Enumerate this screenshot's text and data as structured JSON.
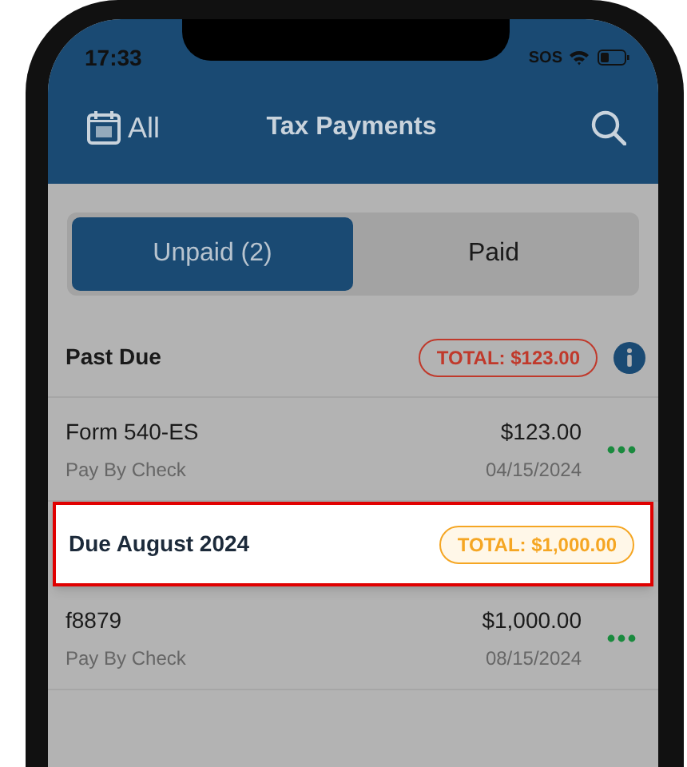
{
  "status_bar": {
    "time": "17:33",
    "carrier": "SOS"
  },
  "nav": {
    "left_label": "All",
    "title": "Tax Payments"
  },
  "tabs": [
    {
      "label": "Unpaid (2)",
      "selected": true
    },
    {
      "label": "Paid",
      "selected": false
    }
  ],
  "sections": [
    {
      "title": "Past Due",
      "total": "TOTAL: $123.00",
      "color": "#c0392b",
      "info": true,
      "highlighted": false,
      "items": [
        {
          "name": "Form 540-ES",
          "method": "Pay By Check",
          "amount": "$123.00",
          "date": "04/15/2024"
        }
      ]
    },
    {
      "title": "Due August 2024",
      "total": "TOTAL: $1,000.00",
      "color": "#f5a623",
      "info": false,
      "highlighted": true,
      "items": [
        {
          "name": "f8879",
          "method": "Pay By Check",
          "amount": "$1,000.00",
          "date": "08/15/2024"
        }
      ]
    }
  ]
}
